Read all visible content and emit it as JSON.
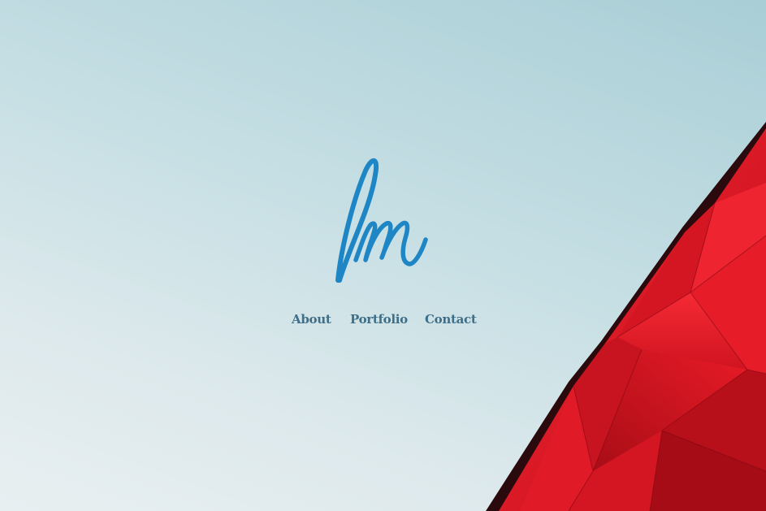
{
  "logo": {
    "monogram": "lm",
    "color": "#1e86c4"
  },
  "nav": {
    "about": "About",
    "portfolio": "Portfolio",
    "contact": "Contact"
  },
  "colors": {
    "sky_top": "#a9ced6",
    "sky_bottom": "#e8eff1",
    "building_red": "#e21a28",
    "nav_text": "#3f6f88"
  }
}
